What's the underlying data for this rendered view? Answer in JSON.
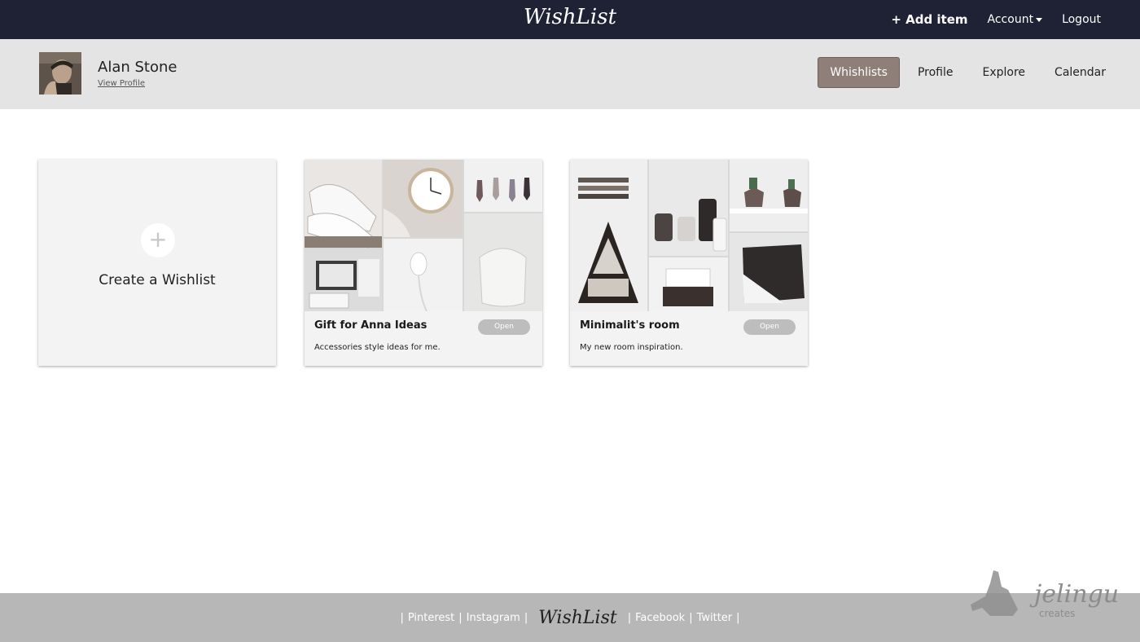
{
  "app": {
    "brand": "WishList"
  },
  "topnav": {
    "add_item": "+ Add item",
    "account": "Account",
    "logout": "Logout"
  },
  "profile": {
    "name": "Alan Stone",
    "view_profile": "View Profile"
  },
  "subnav": {
    "items": [
      "Whishlists",
      "Profile",
      "Explore",
      "Calendar"
    ],
    "active": "Whishlists"
  },
  "create_card": {
    "plus": "+",
    "label": "Create a Wishlist"
  },
  "wishlists": [
    {
      "title": "Gift for Anna Ideas",
      "description": "Accessories style ideas for me.",
      "open_label": "Open"
    },
    {
      "title": "Minimalit's room",
      "description": "My new room inspiration.",
      "open_label": "Open"
    }
  ],
  "footer": {
    "sep": "|",
    "pinterest": "Pinterest",
    "instagram": "Instagram",
    "brand": "WishList",
    "facebook": "Facebook",
    "twitter": "Twitter"
  },
  "watermark": {
    "name": "jelingu",
    "sub": "creates"
  },
  "colors": {
    "navbar": "#1f2135",
    "profilebar": "#e4e4e4",
    "active_tab": "#8e8079",
    "footer": "#b7b7b7",
    "open_button": "#bdbdbd"
  }
}
